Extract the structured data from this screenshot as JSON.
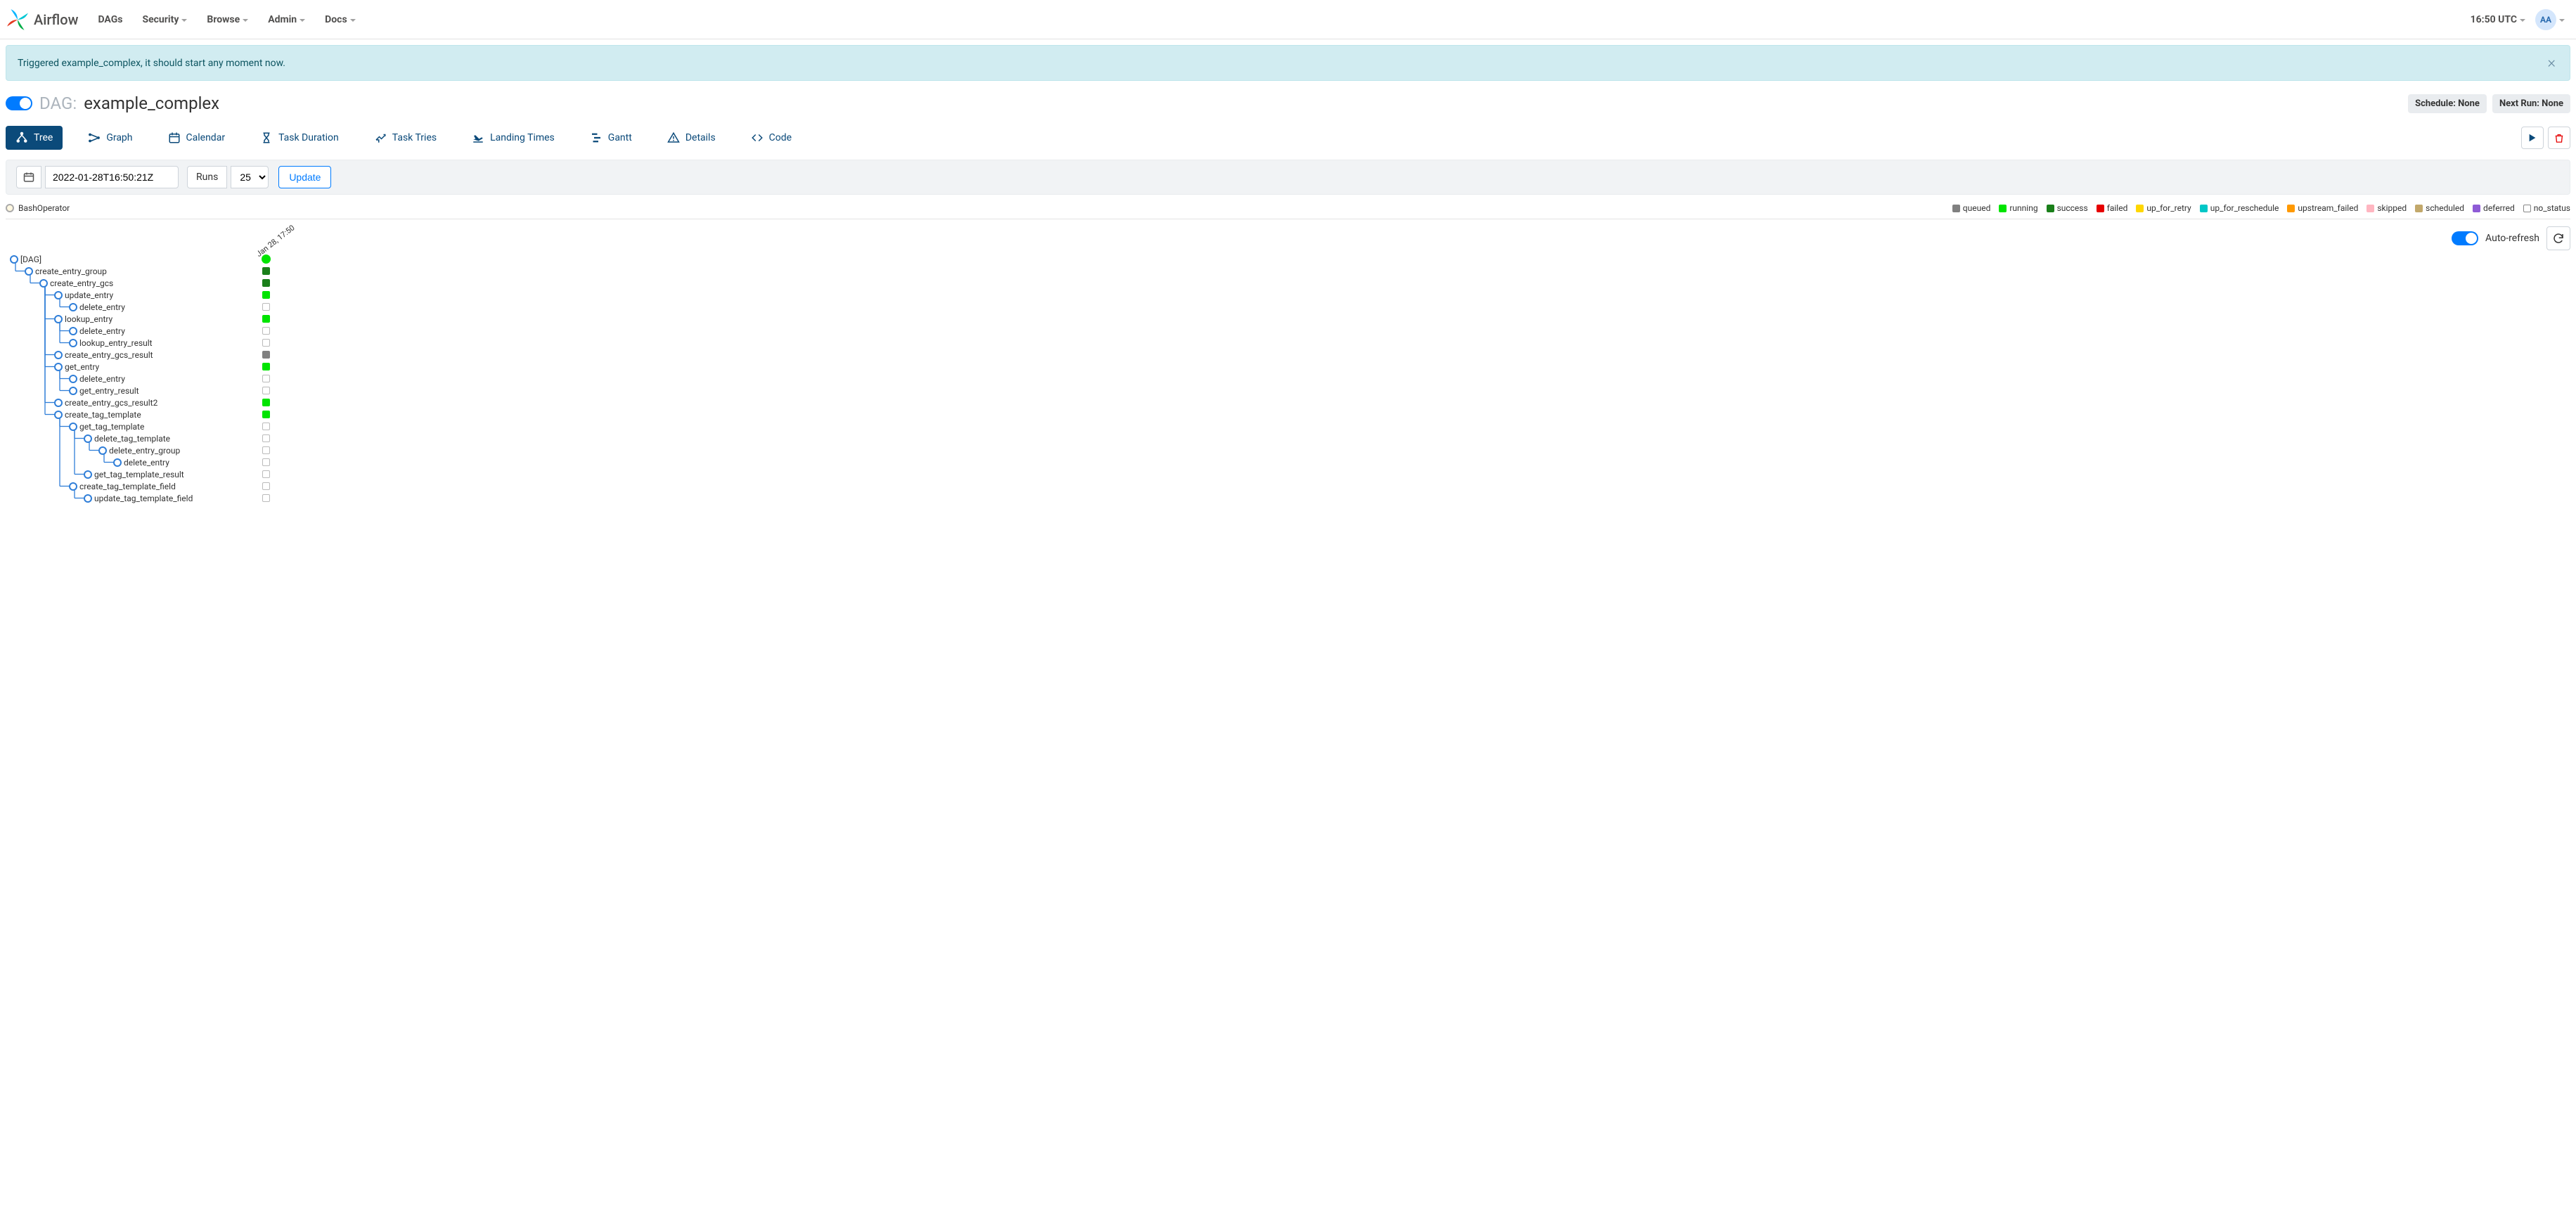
{
  "brand": "Airflow",
  "nav": {
    "items": [
      {
        "label": "DAGs",
        "dropdown": false
      },
      {
        "label": "Security",
        "dropdown": true
      },
      {
        "label": "Browse",
        "dropdown": true
      },
      {
        "label": "Admin",
        "dropdown": true
      },
      {
        "label": "Docs",
        "dropdown": true
      }
    ],
    "timezone": "16:50 UTC",
    "user_initials": "AA"
  },
  "flash": {
    "text": "Triggered example_complex, it should start any moment now."
  },
  "header": {
    "dag_label": "DAG:",
    "dag_name": "example_complex",
    "schedule_pill": "Schedule: None",
    "nextrun_pill": "Next Run: None"
  },
  "tabs": [
    {
      "label": "Tree",
      "active": true
    },
    {
      "label": "Graph",
      "active": false
    },
    {
      "label": "Calendar",
      "active": false
    },
    {
      "label": "Task Duration",
      "active": false
    },
    {
      "label": "Task Tries",
      "active": false
    },
    {
      "label": "Landing Times",
      "active": false
    },
    {
      "label": "Gantt",
      "active": false
    },
    {
      "label": "Details",
      "active": false
    },
    {
      "label": "Code",
      "active": false
    }
  ],
  "filters": {
    "date": "2022-01-28T16:50:21Z",
    "runs_label": "Runs",
    "runs_value": "25",
    "update_label": "Update"
  },
  "operators": [
    {
      "name": "BashOperator"
    }
  ],
  "refresh": {
    "auto_label": "Auto-refresh"
  },
  "tree_run_date": "Jan 28, 17:50",
  "status_colors": {
    "queued": "#808080",
    "running": "#00e400",
    "success": "#1a7f1a",
    "failed": "#e60000",
    "up_for_retry": "#ffd700",
    "up_for_reschedule": "#00c7c7",
    "upstream_failed": "#ff9900",
    "skipped": "#ffb6c1",
    "scheduled": "#c2a86b",
    "deferred": "#8e5bd6",
    "no_status": "#ffffff"
  },
  "status_legend": [
    "queued",
    "running",
    "success",
    "failed",
    "up_for_retry",
    "up_for_reschedule",
    "upstream_failed",
    "skipped",
    "scheduled",
    "deferred",
    "no_status"
  ],
  "tree": {
    "root": "[DAG]",
    "nodes": [
      {
        "indent": 0,
        "label": "[DAG]",
        "status": "running",
        "is_dag": true
      },
      {
        "indent": 1,
        "label": "create_entry_group",
        "status": "success"
      },
      {
        "indent": 2,
        "label": "create_entry_gcs",
        "status": "success"
      },
      {
        "indent": 3,
        "label": "update_entry",
        "status": "running"
      },
      {
        "indent": 4,
        "label": "delete_entry",
        "status": "no_status"
      },
      {
        "indent": 3,
        "label": "lookup_entry",
        "status": "running"
      },
      {
        "indent": 4,
        "label": "delete_entry",
        "status": "no_status"
      },
      {
        "indent": 4,
        "label": "lookup_entry_result",
        "status": "no_status"
      },
      {
        "indent": 3,
        "label": "create_entry_gcs_result",
        "status": "queued"
      },
      {
        "indent": 3,
        "label": "get_entry",
        "status": "running"
      },
      {
        "indent": 4,
        "label": "delete_entry",
        "status": "no_status"
      },
      {
        "indent": 4,
        "label": "get_entry_result",
        "status": "no_status"
      },
      {
        "indent": 3,
        "label": "create_entry_gcs_result2",
        "status": "running"
      },
      {
        "indent": 3,
        "label": "create_tag_template",
        "status": "running"
      },
      {
        "indent": 4,
        "label": "get_tag_template",
        "status": "no_status"
      },
      {
        "indent": 5,
        "label": "delete_tag_template",
        "status": "no_status"
      },
      {
        "indent": 6,
        "label": "delete_entry_group",
        "status": "no_status"
      },
      {
        "indent": 7,
        "label": "delete_entry",
        "status": "no_status"
      },
      {
        "indent": 5,
        "label": "get_tag_template_result",
        "status": "no_status"
      },
      {
        "indent": 4,
        "label": "create_tag_template_field",
        "status": "no_status"
      },
      {
        "indent": 5,
        "label": "update_tag_template_field",
        "status": "no_status"
      }
    ]
  }
}
